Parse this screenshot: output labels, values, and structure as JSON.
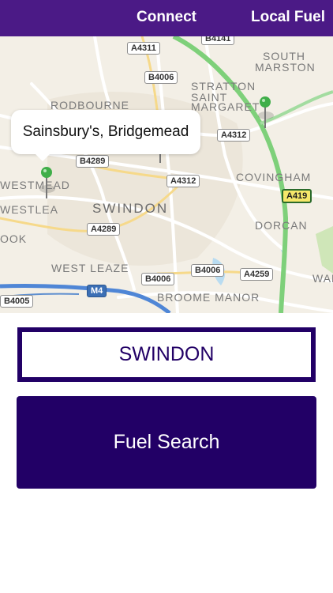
{
  "nav": {
    "left_label": "Connect",
    "right_label": "Local Fuel"
  },
  "map": {
    "callout": "Sainsbury's, Bridgemead",
    "places": {
      "rodbourne": "RODBOURNE",
      "westmead": "WESTMEAD",
      "westlea": "WESTLEA",
      "ook": "OOK",
      "swindon": "SWINDON",
      "stratton1": "STRATTON",
      "stratton2": "SAINT",
      "stratton3": "MARGARET",
      "south_marston1": "SOUTH",
      "south_marston2": "MARSTON",
      "covingham": "COVINGHAM",
      "dorcan": "DORCAN",
      "west_leaze": "WEST LEAZE",
      "broome_manor": "BROOME MANOR",
      "wan": "WAN"
    },
    "roads": {
      "a4311": "A4311",
      "b4006_top": "B4006",
      "b4141": "B4141",
      "a4312_right": "A4312",
      "b4289": "B4289",
      "a4312_mid": "A4312",
      "a419": "A419",
      "a4289": "A4289",
      "b4006_bottom": "B4006",
      "b4006_right": "B4006",
      "a4259": "A4259",
      "m4": "M4",
      "b4005": "B4005"
    }
  },
  "town_input": {
    "value": "SWINDON"
  },
  "search_button": {
    "label": "Fuel Search"
  },
  "colors": {
    "nav_bg": "#4b1a86",
    "brand": "#220066",
    "pin": "#3fae49"
  }
}
